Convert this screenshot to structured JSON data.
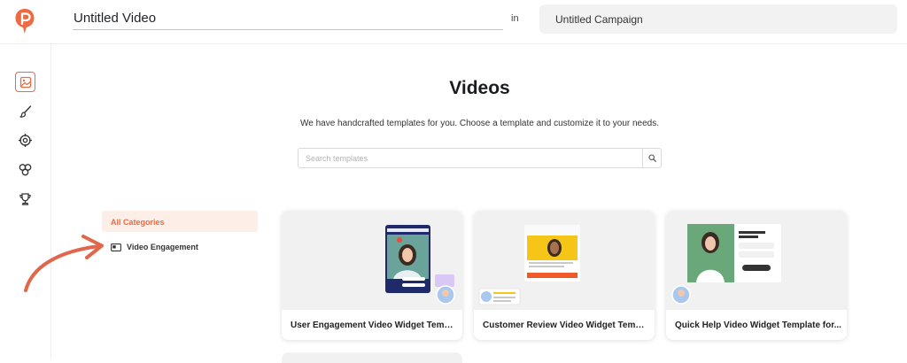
{
  "header": {
    "video_title": "Untitled Video",
    "in_label": "in",
    "campaign_name": "Untitled Campaign"
  },
  "brand": {
    "logo_icon": "pushowl-p-logo-icon",
    "accent": "#ee6a42"
  },
  "sidebar": {
    "items": [
      {
        "icon": "image-icon",
        "active": true
      },
      {
        "icon": "brush-icon",
        "active": false
      },
      {
        "icon": "target-icon",
        "active": false
      },
      {
        "icon": "integrations-icon",
        "active": false
      },
      {
        "icon": "trophy-icon",
        "active": false
      }
    ]
  },
  "main": {
    "title": "Videos",
    "subtitle": "We have handcrafted templates for you. Choose a template and customize it to your needs.",
    "search_placeholder": "Search templates"
  },
  "categories": [
    {
      "label": "All Categories",
      "active": true
    },
    {
      "label": "Video Engagement",
      "active": false
    }
  ],
  "templates": [
    {
      "title": "User Engagement Video Widget Template"
    },
    {
      "title": "Customer Review Video Widget Template"
    },
    {
      "title": "Quick Help Video Widget Template for..."
    }
  ]
}
